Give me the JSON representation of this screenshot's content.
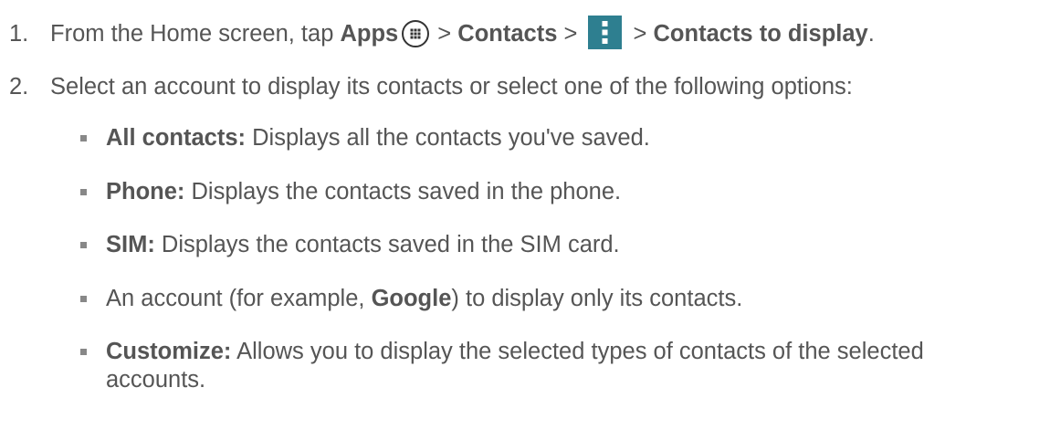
{
  "steps": [
    {
      "number": "1.",
      "text_before": "From the Home screen, tap ",
      "apps_label": "Apps",
      "apps_icon": "apps-grid-icon",
      "sep1": " > ",
      "contacts_label": "Contacts",
      "sep2": " > ",
      "menu_icon": "more-vertical-icon",
      "sep3": " > ",
      "target_label": "Contacts to display",
      "end": "."
    },
    {
      "number": "2.",
      "text": "Select an account to display its contacts or select one of the following options:"
    }
  ],
  "options": [
    {
      "bold": "All contacts:",
      "text": " Displays all the contacts you've saved."
    },
    {
      "bold": "Phone:",
      "text": " Displays the contacts saved in the phone."
    },
    {
      "bold": "SIM:",
      "text": " Displays the contacts saved in the SIM card."
    },
    {
      "pre": "An account (for example, ",
      "bold": "Google",
      "text": ") to display only its contacts."
    },
    {
      "bold": "Customize:",
      "text": " Allows you to display the selected types of contacts of the selected accounts."
    }
  ],
  "colors": {
    "text": "#555555",
    "menu_icon_bg": "#2e7f90",
    "bullet": "#888888"
  }
}
